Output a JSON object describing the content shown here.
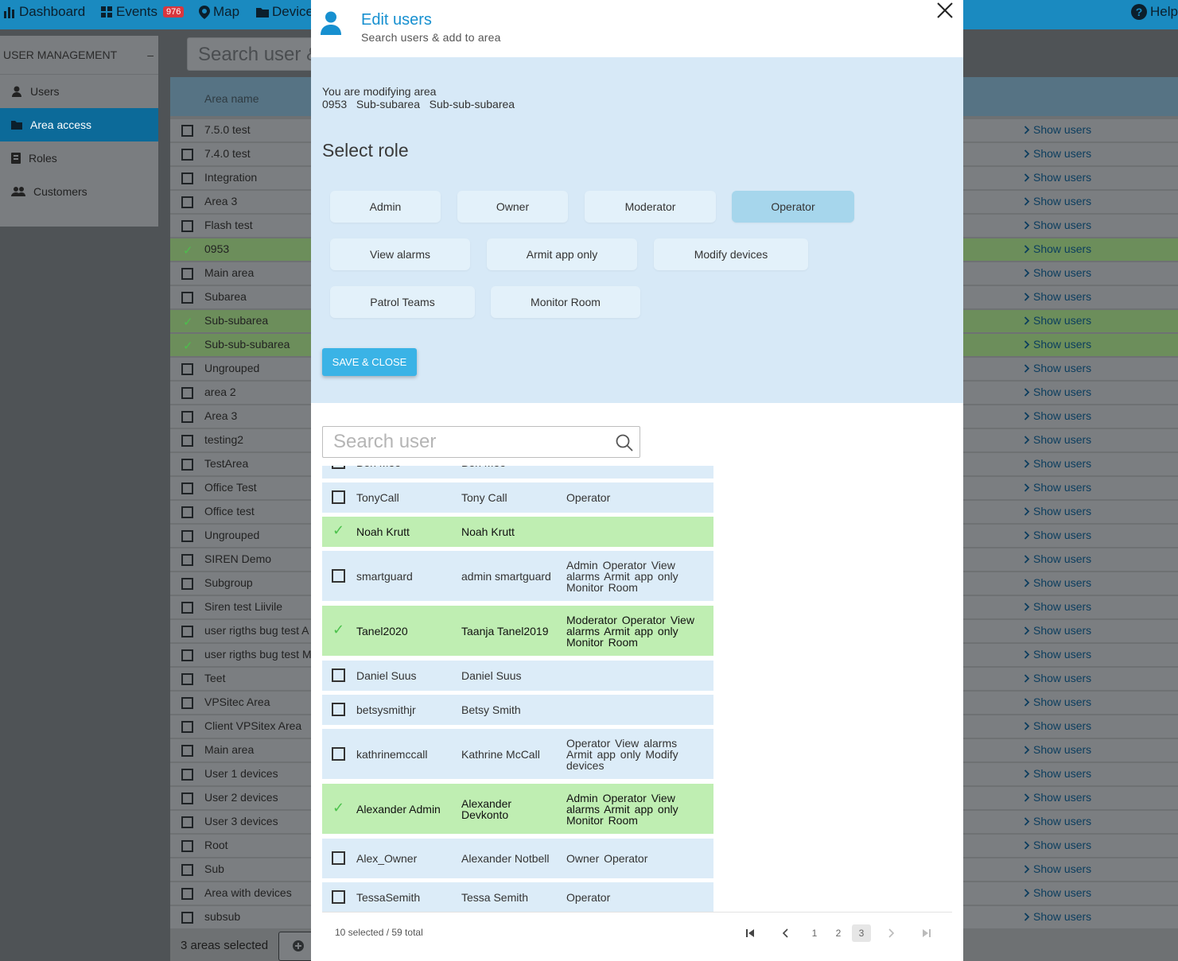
{
  "topbar": {
    "dashboard": "Dashboard",
    "events": "Events",
    "events_badge": "976",
    "map": "Map",
    "devices": "Devices",
    "help": "Help"
  },
  "sidebar": {
    "header": "USER MANAGEMENT",
    "collapse": "–",
    "items": [
      {
        "label": "Users",
        "icon": "person-icon",
        "active": false
      },
      {
        "label": "Area access",
        "icon": "folder-icon",
        "active": true
      },
      {
        "label": "Roles",
        "icon": "badge-icon",
        "active": false
      },
      {
        "label": "Customers",
        "icon": "group-icon",
        "active": false
      }
    ]
  },
  "bg_search_text": "Search user &",
  "areas_table": {
    "header": "Area name",
    "show_users": "Show users",
    "rows": [
      {
        "name": "7.5.0 test",
        "selected": false
      },
      {
        "name": "7.4.0 test",
        "selected": false
      },
      {
        "name": "Integration",
        "selected": false
      },
      {
        "name": "Area 3",
        "selected": false
      },
      {
        "name": "Flash test",
        "selected": false
      },
      {
        "name": "0953",
        "selected": true
      },
      {
        "name": "Main area",
        "selected": false
      },
      {
        "name": "Subarea",
        "selected": false
      },
      {
        "name": "Sub-subarea",
        "selected": true
      },
      {
        "name": "Sub-sub-subarea",
        "selected": true
      },
      {
        "name": "Ungrouped",
        "selected": false
      },
      {
        "name": "area 2",
        "selected": false
      },
      {
        "name": "Area 3",
        "selected": false
      },
      {
        "name": "testing2",
        "selected": false
      },
      {
        "name": "TestArea",
        "selected": false
      },
      {
        "name": "Office Test",
        "selected": false
      },
      {
        "name": "Office test",
        "selected": false
      },
      {
        "name": "Ungrouped",
        "selected": false
      },
      {
        "name": "SIREN Demo",
        "selected": false
      },
      {
        "name": "Subgroup",
        "selected": false
      },
      {
        "name": "Siren test Liivile",
        "selected": false
      },
      {
        "name": "user rigths bug test A",
        "selected": false
      },
      {
        "name": "user rigths bug test M",
        "selected": false
      },
      {
        "name": "Teet",
        "selected": false
      },
      {
        "name": "VPSitec Area",
        "selected": false
      },
      {
        "name": "Client VPSitex Area",
        "selected": false
      },
      {
        "name": "Main area",
        "selected": false
      },
      {
        "name": "User 1 devices",
        "selected": false
      },
      {
        "name": "User 2 devices",
        "selected": false
      },
      {
        "name": "User 3 devices",
        "selected": false
      },
      {
        "name": "Root",
        "selected": false
      },
      {
        "name": "Sub",
        "selected": false
      },
      {
        "name": "Area with devices",
        "selected": false
      },
      {
        "name": "subsub",
        "selected": false
      }
    ]
  },
  "bottom_status": "3 areas selected",
  "modal": {
    "title": "Edit users",
    "subtitle": "Search users & add to area",
    "modifying_label": "You are modifying area",
    "area_path": "0953   Sub-subarea   Sub-sub-subarea",
    "select_role": "Select role",
    "roles": [
      {
        "label": "Admin",
        "active": false
      },
      {
        "label": "Owner",
        "active": false
      },
      {
        "label": "Moderator",
        "active": false
      },
      {
        "label": "Operator",
        "active": true
      },
      {
        "label": "View alarms",
        "active": false
      },
      {
        "label": "Armit app only",
        "active": false
      },
      {
        "label": "Modify devices",
        "active": false
      },
      {
        "label": "Patrol Teams",
        "active": false
      },
      {
        "label": "Monitor Room",
        "active": false
      }
    ],
    "save_label": "SAVE & CLOSE",
    "search_placeholder": "Search user",
    "users": [
      {
        "username": "Ben Moo",
        "name": "Ben Moo",
        "roles": "",
        "selected": false
      },
      {
        "username": "TonyCall",
        "name": "Tony Call",
        "roles": "Operator",
        "selected": false
      },
      {
        "username": "Noah Krutt",
        "name": "Noah Krutt",
        "roles": "",
        "selected": true
      },
      {
        "username": "smartguard",
        "name": "admin smartguard",
        "roles": "Admin Operator View alarms Armit app only Monitor Room",
        "selected": false
      },
      {
        "username": "Tanel2020",
        "name": "Taanja Tanel2019",
        "roles": "Moderator Operator View alarms Armit app only Monitor Room",
        "selected": true
      },
      {
        "username": "Daniel Suus",
        "name": "Daniel Suus",
        "roles": "",
        "selected": false
      },
      {
        "username": "betsysmithjr",
        "name": "Betsy Smith",
        "roles": "",
        "selected": false
      },
      {
        "username": "kathrinemccall",
        "name": "Kathrine McCall",
        "roles": "Operator View alarms Armit app only Modify devices",
        "selected": false
      },
      {
        "username": "Alexander Admin",
        "name": "Alexander Devkonto",
        "roles": "Admin Operator View alarms Armit app only Monitor Room",
        "selected": true
      },
      {
        "username": "Alex_Owner",
        "name": "Alexander Notbell",
        "roles": "Owner Operator",
        "selected": false
      },
      {
        "username": "TessaSemith",
        "name": "Tessa Semith",
        "roles": "Operator",
        "selected": false
      }
    ],
    "selection_summary": "10 selected / 59 total",
    "pages": [
      "1",
      "2",
      "3"
    ],
    "current_page": "3"
  }
}
